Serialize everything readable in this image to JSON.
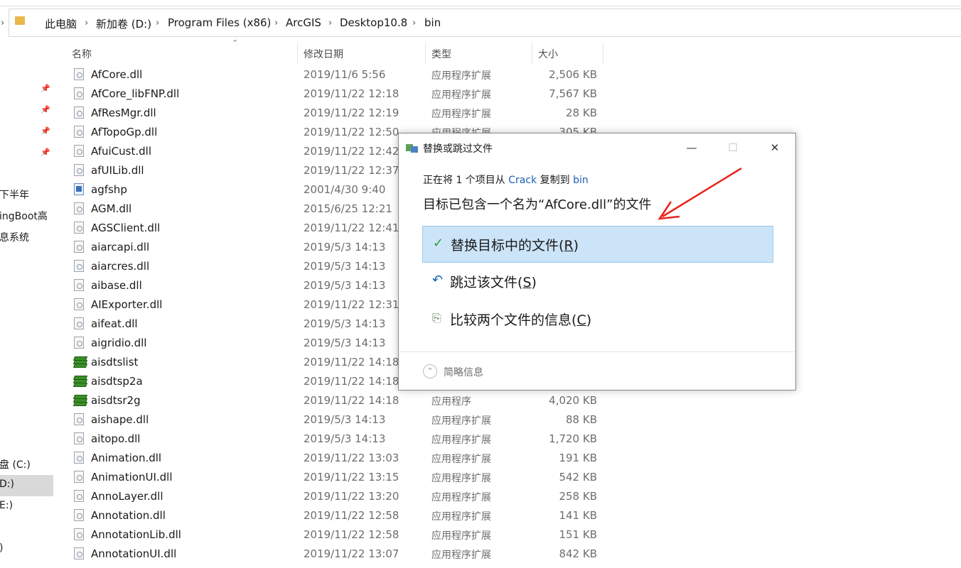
{
  "breadcrumb": [
    "此电脑",
    "新加卷 (D:)",
    "Program Files (x86)",
    "ArcGIS",
    "Desktop10.8",
    "bin"
  ],
  "nav_items": [
    "下半年",
    "ingBoot高",
    "息系统",
    "盘 (C:)",
    "D:)",
    "E:)",
    ")"
  ],
  "columns": {
    "name": "名称",
    "date": "修改日期",
    "type": "类型",
    "size": "大小"
  },
  "files": [
    {
      "icon": "dll",
      "name": "AfCore.dll",
      "date": "2019/11/6 5:56",
      "type": "应用程序扩展",
      "size": "2,506 KB"
    },
    {
      "icon": "dll",
      "name": "AfCore_libFNP.dll",
      "date": "2019/11/22 12:18",
      "type": "应用程序扩展",
      "size": "7,567 KB"
    },
    {
      "icon": "dll",
      "name": "AfResMgr.dll",
      "date": "2019/11/22 12:19",
      "type": "应用程序扩展",
      "size": "28 KB"
    },
    {
      "icon": "dll",
      "name": "AfTopoGp.dll",
      "date": "2019/11/22 12:50",
      "type": "应用程序扩展",
      "size": "305 KB"
    },
    {
      "icon": "dll",
      "name": "AfuiCust.dll",
      "date": "2019/11/22 12:42",
      "type": "",
      "size": ""
    },
    {
      "icon": "dll",
      "name": "afUILib.dll",
      "date": "2019/11/22 12:37",
      "type": "",
      "size": ""
    },
    {
      "icon": "exe",
      "name": "agfshp",
      "date": "2001/4/30 9:40",
      "type": "",
      "size": ""
    },
    {
      "icon": "dll",
      "name": "AGM.dll",
      "date": "2015/6/25 12:21",
      "type": "",
      "size": ""
    },
    {
      "icon": "dll",
      "name": "AGSClient.dll",
      "date": "2019/11/22 12:41",
      "type": "",
      "size": ""
    },
    {
      "icon": "dll",
      "name": "aiarcapi.dll",
      "date": "2019/5/3 14:13",
      "type": "",
      "size": ""
    },
    {
      "icon": "dll",
      "name": "aiarcres.dll",
      "date": "2019/5/3 14:13",
      "type": "",
      "size": ""
    },
    {
      "icon": "dll",
      "name": "aibase.dll",
      "date": "2019/5/3 14:13",
      "type": "",
      "size": ""
    },
    {
      "icon": "dll",
      "name": "AIExporter.dll",
      "date": "2019/11/22 12:31",
      "type": "",
      "size": ""
    },
    {
      "icon": "dll",
      "name": "aifeat.dll",
      "date": "2019/5/3 14:13",
      "type": "",
      "size": ""
    },
    {
      "icon": "dll",
      "name": "aigridio.dll",
      "date": "2019/5/3 14:13",
      "type": "",
      "size": ""
    },
    {
      "icon": "stack",
      "name": "aisdtslist",
      "date": "2019/11/22 14:18",
      "type": "",
      "size": ""
    },
    {
      "icon": "stack",
      "name": "aisdtsp2a",
      "date": "2019/11/22 14:18",
      "type": "",
      "size": ""
    },
    {
      "icon": "stack",
      "name": "aisdtsr2g",
      "date": "2019/11/22 14:18",
      "type": "应用程序",
      "size": "4,020 KB"
    },
    {
      "icon": "dll",
      "name": "aishape.dll",
      "date": "2019/5/3 14:13",
      "type": "应用程序扩展",
      "size": "88 KB"
    },
    {
      "icon": "dll",
      "name": "aitopo.dll",
      "date": "2019/5/3 14:13",
      "type": "应用程序扩展",
      "size": "1,720 KB"
    },
    {
      "icon": "dll",
      "name": "Animation.dll",
      "date": "2019/11/22 13:03",
      "type": "应用程序扩展",
      "size": "191 KB"
    },
    {
      "icon": "dll",
      "name": "AnimationUI.dll",
      "date": "2019/11/22 13:15",
      "type": "应用程序扩展",
      "size": "542 KB"
    },
    {
      "icon": "dll",
      "name": "AnnoLayer.dll",
      "date": "2019/11/22 13:20",
      "type": "应用程序扩展",
      "size": "258 KB"
    },
    {
      "icon": "dll",
      "name": "Annotation.dll",
      "date": "2019/11/22 12:58",
      "type": "应用程序扩展",
      "size": "141 KB"
    },
    {
      "icon": "dll",
      "name": "AnnotationLib.dll",
      "date": "2019/11/22 12:58",
      "type": "应用程序扩展",
      "size": "151 KB"
    },
    {
      "icon": "dll",
      "name": "AnnotationUI.dll",
      "date": "2019/11/22 13:07",
      "type": "应用程序扩展",
      "size": "842 KB"
    }
  ],
  "dialog": {
    "title": "替换或跳过文件",
    "minimize": "—",
    "maximize": "☐",
    "close": "✕",
    "line1_prefix": "正在将 1 个项目从 ",
    "source": "Crack",
    "line1_mid": " 复制到 ",
    "dest": "bin",
    "message": "目标已包含一个名为“AfCore.dll”的文件",
    "options": [
      {
        "icon": "checkmark-icon",
        "label_text": "替换目标中的文件",
        "key": "R"
      },
      {
        "icon": "skip-icon",
        "label_text": "跳过该文件",
        "key": "S"
      },
      {
        "icon": "compare-icon",
        "label_text": "比较两个文件的信息",
        "key": "C"
      }
    ],
    "footer": "简略信息"
  },
  "colors": {
    "accent": "#1a5fb4",
    "selected_bg": "#cce4f7",
    "annotation_arrow": "#e8231e"
  }
}
